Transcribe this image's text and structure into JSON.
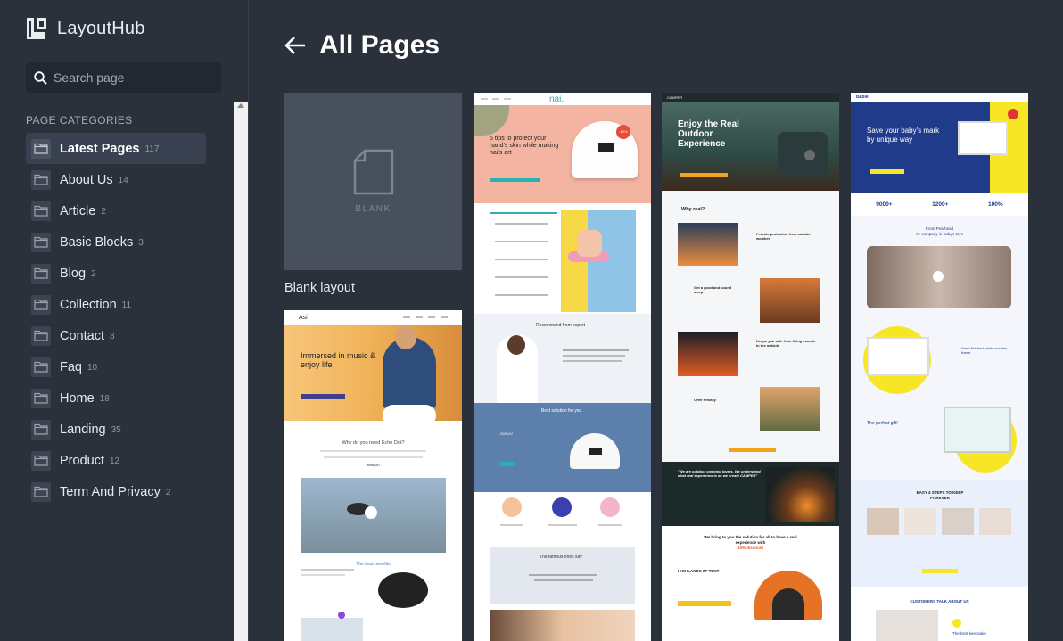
{
  "app": {
    "name": "LayoutHub"
  },
  "search": {
    "placeholder": "Search page"
  },
  "sidebar": {
    "heading": "PAGE CATEGORIES",
    "categories": [
      {
        "label": "Latest Pages",
        "count": "117",
        "active": true
      },
      {
        "label": "About Us",
        "count": "14"
      },
      {
        "label": "Article",
        "count": "2"
      },
      {
        "label": "Basic Blocks",
        "count": "3"
      },
      {
        "label": "Blog",
        "count": "2"
      },
      {
        "label": "Collection",
        "count": "11"
      },
      {
        "label": "Contact",
        "count": "8"
      },
      {
        "label": "Faq",
        "count": "10"
      },
      {
        "label": "Home",
        "count": "18"
      },
      {
        "label": "Landing",
        "count": "35"
      },
      {
        "label": "Product",
        "count": "12"
      },
      {
        "label": "Term And Privacy",
        "count": "2"
      }
    ]
  },
  "main": {
    "title": "All Pages",
    "blank": {
      "label": "BLANK",
      "caption": "Blank layout"
    },
    "cards": {
      "nails": {
        "brand": "nai.",
        "headline": "5 tips to protect your hand's skin while making nails art",
        "badge": "-10%",
        "section_expert": "Recommend from expert",
        "section_best": "Best solution for you",
        "section_famous": "The famous ones say",
        "brand_mark": "SUNUV"
      },
      "outdoor": {
        "brand": "CAMPER",
        "headline": "Enjoy the Real Outdoor Experience",
        "why": "Why real?",
        "f1": "Provide protection from outside weather",
        "f2": "Get a good and sound sleep",
        "f3": "Keeps you safe from flying insects in the outside",
        "f4": "Offer Privacy",
        "quote": "\"We are outdoor camping lovers. We understand what real experience is so we create CAMPER\"",
        "solution": "We bring to you the solution for all to have a real experience with",
        "discount": "10% discount",
        "product": "HIGHLANDS 2P TENT"
      },
      "baby": {
        "brand": "Babie",
        "headline": "Save your baby's mark by unique way",
        "stat1": "9000+",
        "stat2": "1200+",
        "stat3": "100%",
        "from": "From Pearhead",
        "sub": "#1 company in baby's toys",
        "f1": "Hand-finished, white wooden frame",
        "gift": "The perfect gift!",
        "steps": "EASY 4 STEPS TO KEEP FOREVER",
        "talk": "CUSTOMERS TALK ABOUT US",
        "best": "The best keepsake"
      },
      "music": {
        "brand": "Asi",
        "headline": "Immersed in music & enjoy life",
        "why": "Why do you need Echo Dot?",
        "benefits": "The best benefits",
        "brand_mark": "amazon"
      }
    }
  }
}
